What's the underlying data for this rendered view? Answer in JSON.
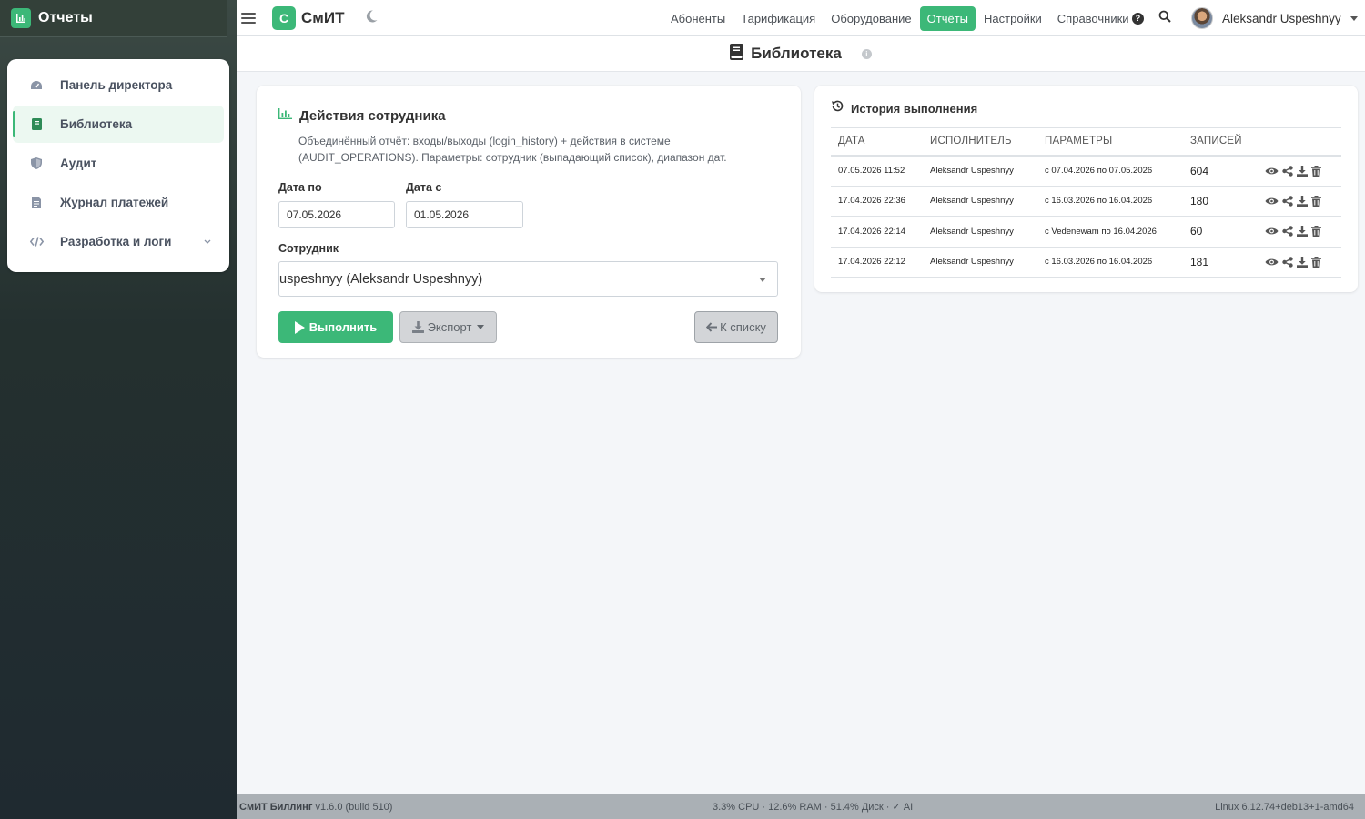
{
  "sidebar": {
    "brand": "Отчеты",
    "items": [
      {
        "label": "Панель директора",
        "icon": "dashboard-icon"
      },
      {
        "label": "Библиотека",
        "icon": "book-icon"
      },
      {
        "label": "Аудит",
        "icon": "shield-icon"
      },
      {
        "label": "Журнал платежей",
        "icon": "file-invoice-icon"
      },
      {
        "label": "Разработка и логи",
        "icon": "code-icon"
      }
    ]
  },
  "topbar": {
    "app_logo": "С",
    "app_name": "СмИТ",
    "nav": [
      "Абоненты",
      "Тарификация",
      "Оборудование",
      "Отчёты",
      "Настройки",
      "Справочники"
    ],
    "active_nav": "Отчёты",
    "help": "?",
    "user_name": "Aleksandr Uspeshnyy"
  },
  "page": {
    "title": "Библиотека",
    "info": "i"
  },
  "report": {
    "title": "Действия сотрудника",
    "description": "Объединённый отчёт: входы/выходы (login_history) + действия в системе (AUDIT_OPERATIONS). Параметры: сотрудник (выпадающий список), диапазон дат.",
    "date_to_label": "Дата по",
    "date_to_value": "07.05.2026",
    "date_from_label": "Дата с",
    "date_from_value": "01.05.2026",
    "employee_label": "Сотрудник",
    "employee_value": "uspeshnyy (Aleksandr Uspeshnyy)",
    "run_button": "Выполнить",
    "export_button": "Экспорт",
    "back_button": "К списку"
  },
  "history": {
    "title": "История выполнения",
    "columns": [
      "ДАТА",
      "ИСПОЛНИТЕЛЬ",
      "ПАРАМЕТРЫ",
      "ЗАПИСЕЙ",
      ""
    ],
    "rows": [
      {
        "date": "07.05.2026 11:52",
        "user": "Aleksandr Uspeshnyy",
        "params": "с 07.04.2026 по 07.05.2026",
        "count": "604"
      },
      {
        "date": "17.04.2026 22:36",
        "user": "Aleksandr Uspeshnyy",
        "params": "с 16.03.2026 по 16.04.2026",
        "count": "180"
      },
      {
        "date": "17.04.2026 22:14",
        "user": "Aleksandr Uspeshnyy",
        "params": "с Vedenewam по 16.04.2026",
        "count": "60"
      },
      {
        "date": "17.04.2026 22:12",
        "user": "Aleksandr Uspeshnyy",
        "params": "с 16.03.2026 по 16.04.2026",
        "count": "181"
      }
    ]
  },
  "footer": {
    "app": "СмИТ Биллинг",
    "version": "v1.6.0 (build 510)",
    "stats": "3.3% CPU · 12.6% RAM · 51.4% Диск · ✓ AI",
    "os": "Linux 6.12.74+deb13+1-amd64"
  },
  "colors": {
    "accent": "#3cb878",
    "sidebar_bg": "#24302f",
    "footer_bg": "#aab0b5"
  }
}
